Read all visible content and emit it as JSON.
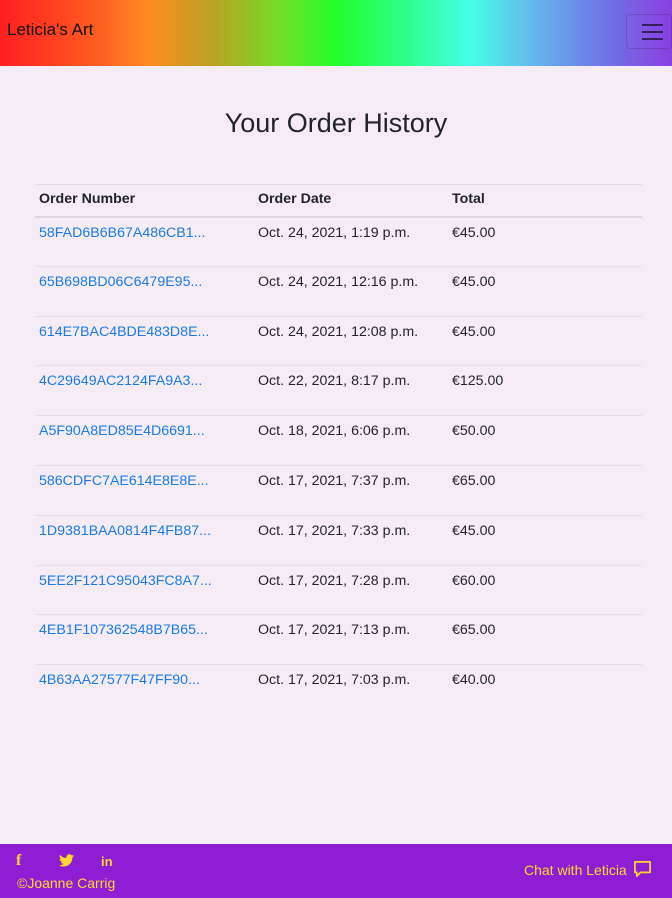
{
  "navbar": {
    "brand": "Leticia's Art",
    "toggler_icon": "hamburger-icon"
  },
  "page": {
    "title": "Your Order History"
  },
  "table": {
    "headers": [
      "Order Number",
      "Order Date",
      "Total"
    ],
    "rows": [
      {
        "number": "58FAD6B6B67A486CB1...",
        "date": "Oct. 24, 2021, 1:19 p.m.",
        "total": "€45.00"
      },
      {
        "number": "65B698BD06C6479E95...",
        "date": "Oct. 24, 2021, 12:16 p.m.",
        "total": "€45.00"
      },
      {
        "number": "614E7BAC4BDE483D8E...",
        "date": "Oct. 24, 2021, 12:08 p.m.",
        "total": "€45.00"
      },
      {
        "number": "4C29649AC2124FA9A3...",
        "date": "Oct. 22, 2021, 8:17 p.m.",
        "total": "€125.00"
      },
      {
        "number": "A5F90A8ED85E4D6691...",
        "date": "Oct. 18, 2021, 6:06 p.m.",
        "total": "€50.00"
      },
      {
        "number": "586CDFC7AE614E8E8E...",
        "date": "Oct. 17, 2021, 7:37 p.m.",
        "total": "€65.00"
      },
      {
        "number": "1D9381BAA0814F4FB87...",
        "date": "Oct. 17, 2021, 7:33 p.m.",
        "total": "€45.00"
      },
      {
        "number": "5EE2F121C95043FC8A7...",
        "date": "Oct. 17, 2021, 7:28 p.m.",
        "total": "€60.00"
      },
      {
        "number": "4EB1F107362548B7B65...",
        "date": "Oct. 17, 2021, 7:13 p.m.",
        "total": "€65.00"
      },
      {
        "number": "4B63AA27577F47FF90...",
        "date": "Oct. 17, 2021, 7:03 p.m.",
        "total": "€40.00"
      }
    ]
  },
  "footer": {
    "social": {
      "facebook": "f",
      "twitter": "twitter-icon",
      "linkedin": "in"
    },
    "copyright": "©Joanne Carrig",
    "chat_label": "Chat with Leticia",
    "chat_icon": "chat-bubble-icon"
  },
  "colors": {
    "background": "#f6ecf5",
    "link": "#1a7be6",
    "footer_bg": "#8e1dd3",
    "footer_text": "#ffd92e"
  }
}
